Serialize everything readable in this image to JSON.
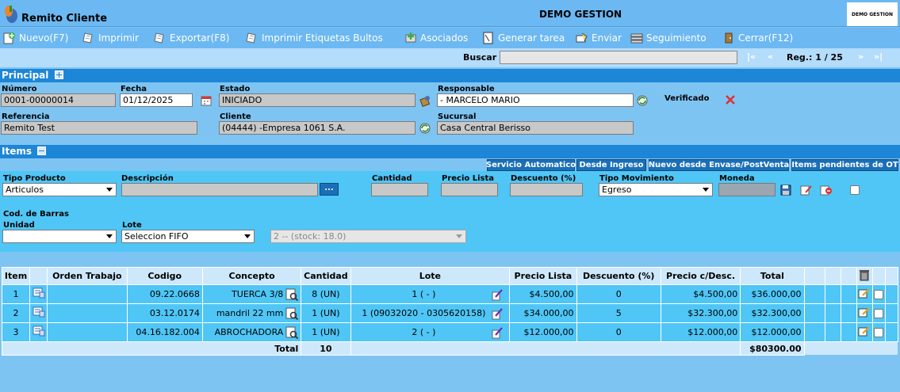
{
  "app": {
    "title": "Remito Cliente",
    "company": "DEMO GESTION",
    "brand": "DEMO GESTION"
  },
  "toolbar": {
    "nuevo": "Nuevo(F7)",
    "imprimir": "Imprimir",
    "exportar": "Exportar(F8)",
    "etiquetas": "Imprimir Etiquetas Bultos",
    "asociados": "Asociados",
    "generar_tarea": "Generar tarea",
    "enviar": "Enviar",
    "seguimiento": "Seguimiento",
    "cerrar": "Cerrar(F12)"
  },
  "search": {
    "label": "Buscar",
    "value": "",
    "first": "|«",
    "prev": "«",
    "reg": "Reg.: 1 / 25",
    "next": "»",
    "last": "»|"
  },
  "principal": {
    "title": "Principal",
    "numero_label": "Número",
    "numero": "0001-00000014",
    "fecha_label": "Fecha",
    "fecha": "01/12/2025",
    "estado_label": "Estado",
    "estado": "INICIADO",
    "responsable_label": "Responsable",
    "responsable": "- MARCELO MARIO",
    "verificado_label": "Verificado",
    "referencia_label": "Referencia",
    "referencia": "Remito Test",
    "cliente_label": "Cliente",
    "cliente": "(04444) -Empresa 1061 S.A.",
    "sucursal_label": "Sucursal",
    "sucursal": "Casa Central Berisso"
  },
  "items": {
    "title": "Items",
    "tabs": {
      "servicio": "Servicio Automatico",
      "ingreso": "Desde Ingreso",
      "envase": "Nuevo desde Envase/PostVenta",
      "pendientes": "Items pendientes de OT"
    },
    "form": {
      "tipo_producto_label": "Tipo Producto",
      "tipo_producto": "Articulos",
      "descripcion_label": "Descripción",
      "descripcion_btn": "...",
      "cantidad_label": "Cantidad",
      "precio_lista_label": "Precio Lista",
      "descuento_label": "Descuento (%)",
      "tipo_movimiento_label": "Tipo Movimiento",
      "tipo_movimiento": "Egreso",
      "moneda_label": "Moneda",
      "cod_barras_label": "Cod. de Barras",
      "unidad_label": "Unidad",
      "unidad": "",
      "lote_label": "Lote",
      "lote": "Seleccion FIFO",
      "stock": "2 -- (stock: 18.0)"
    }
  },
  "grid": {
    "headers": {
      "item": "Item",
      "orden": "Orden Trabajo",
      "codigo": "Codigo",
      "concepto": "Concepto",
      "cantidad": "Cantidad",
      "lote": "Lote",
      "precio_lista": "Precio Lista",
      "descuento": "Descuento (%)",
      "precio_desc": "Precio c/Desc.",
      "total": "Total"
    },
    "rows": [
      {
        "item": "1",
        "orden": "",
        "codigo": "09.22.0668",
        "concepto": "TUERCA 3/8",
        "cantidad": "8 (UN)",
        "lote": "1 ( - )",
        "precio_lista": "$4.500,00",
        "descuento": "0",
        "precio_desc": "$4.500,00",
        "total": "$36.000,00"
      },
      {
        "item": "2",
        "orden": "",
        "codigo": "03.12.0174",
        "concepto": "mandril 22 mm",
        "cantidad": "1 (UN)",
        "lote": "1 (09032020 - 0305620158)",
        "precio_lista": "$34.000,00",
        "descuento": "5",
        "precio_desc": "$32.300,00",
        "total": "$32.300,00"
      },
      {
        "item": "3",
        "orden": "",
        "codigo": "04.16.182.004",
        "concepto": "ABROCHADORA",
        "cantidad": "1 (UN)",
        "lote": "2 ( - )",
        "precio_lista": "$12.000,00",
        "descuento": "0",
        "precio_desc": "$12.000,00",
        "total": "$12.000,00"
      }
    ],
    "total_label": "Total",
    "total_cantidad": "10",
    "total_importe": "$80300.00"
  }
}
